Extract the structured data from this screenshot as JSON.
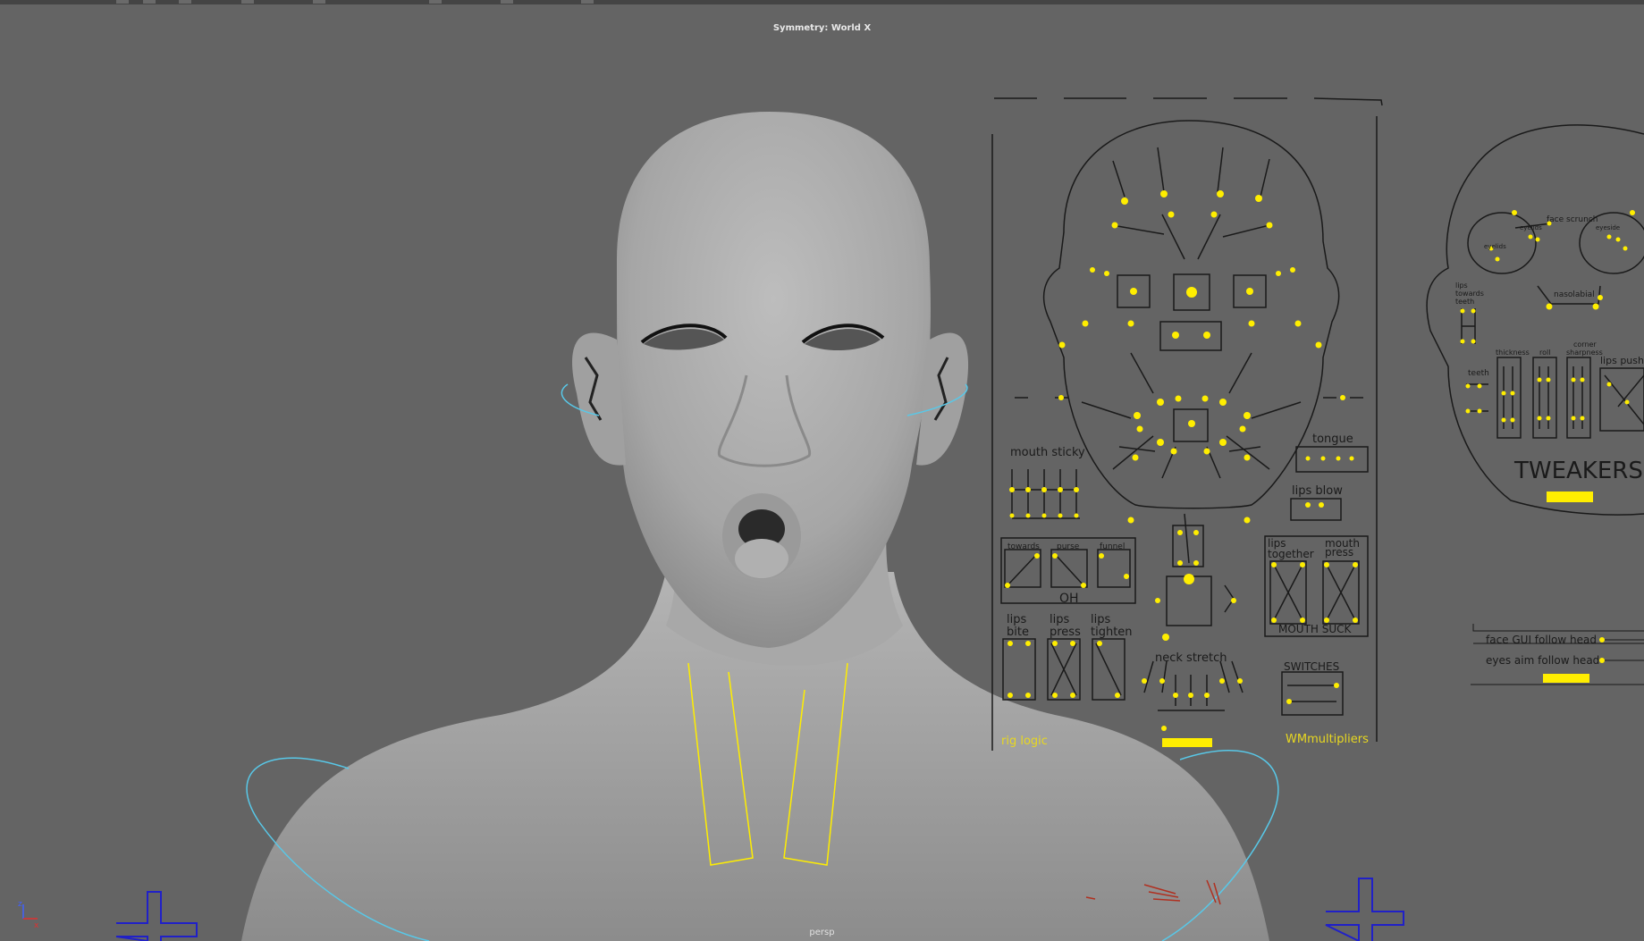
{
  "viewport": {
    "symmetry_label": "Symmetry: World X",
    "camera_label": "persp",
    "axis_labels": {
      "z": "z",
      "x": "x"
    }
  },
  "face_gui": {
    "mouth_sticky": "mouth sticky",
    "tongue": "tongue",
    "tips_blow": "lips blow",
    "towards": "towards",
    "purse": "purse",
    "funnel": "funnel",
    "oh": "OH",
    "lips_together_1": "lips",
    "lips_together_2": "together",
    "mouth_press_1": "mouth",
    "mouth_press_2": "press",
    "lips_bite_1": "lips",
    "lips_bite_2": "bite",
    "lips_press_1": "lips",
    "lips_press_2": "press",
    "lips_tighten_1": "lips",
    "lips_tighten_2": "tighten",
    "mouth_suck": "MOUTH SUCK",
    "neck_stretch": "neck stretch",
    "switches": "SWITCHES",
    "rig_logic": "rig logic",
    "wm_multipliers": "WMmultipliers"
  },
  "tweakers": {
    "title": "TWEAKERS",
    "face_scrunch": "face scrunch",
    "eyelids": "eyelids",
    "eyeside": "eyeside",
    "eyeline": "eyelids",
    "nasolabial": "nasolabial",
    "lips_towards_teeth_1": "lips",
    "lips_towards_teeth_2": "towards",
    "lips_towards_teeth_3": "teeth",
    "teeth": "teeth",
    "thickness": "thickness",
    "roll": "roll",
    "corner_sharpness_1": "corner",
    "corner_sharpness_2": "sharpness",
    "lips_push": "lips push"
  },
  "follow_panel": {
    "face_gui_follow_head": "face GUI follow head",
    "eyes_aim_follow_head": "eyes aim follow head"
  },
  "colors": {
    "background": "#646464",
    "control_yellow": "#ffee00",
    "curve_cyan": "#58c8e8",
    "locator_blue": "#2020c8",
    "label_yellow": "#e8d820",
    "gui_line": "#1a1a1a"
  }
}
